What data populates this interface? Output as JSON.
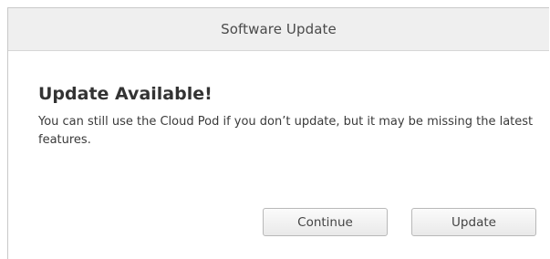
{
  "window": {
    "title": "Software Update"
  },
  "dialog": {
    "heading": "Update Available!",
    "message": "You can still use the Cloud Pod if you don’t update, but it may be missing the latest features."
  },
  "buttons": {
    "continue_label": "Continue",
    "update_label": "Update"
  }
}
